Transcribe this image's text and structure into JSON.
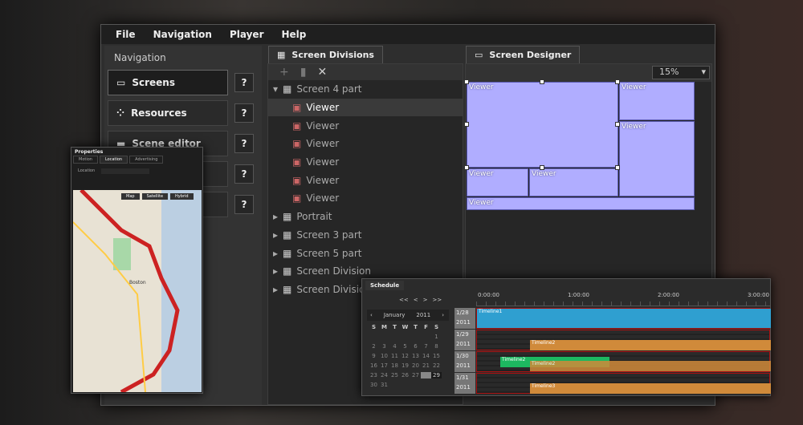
{
  "menu": [
    "File",
    "Navigation",
    "Player",
    "Help"
  ],
  "nav": {
    "title": "Navigation",
    "items": [
      "Screens",
      "Resources",
      "Scene editor"
    ],
    "help": "?"
  },
  "divisions": {
    "tab": "Screen Divisions",
    "tree": [
      {
        "label": "Screen 4 part",
        "expanded": true
      },
      {
        "label": "Viewer",
        "child": true,
        "selected": true
      },
      {
        "label": "Viewer",
        "child": true
      },
      {
        "label": "Viewer",
        "child": true
      },
      {
        "label": "Viewer",
        "child": true
      },
      {
        "label": "Viewer",
        "child": true
      },
      {
        "label": "Viewer",
        "child": true
      },
      {
        "label": "Portrait"
      },
      {
        "label": "Screen 3 part"
      },
      {
        "label": "Screen 5 part"
      },
      {
        "label": "Screen Division"
      },
      {
        "label": "Screen Division"
      }
    ]
  },
  "designer": {
    "tab": "Screen Designer",
    "zoom": "15%",
    "viewer": "Viewer"
  },
  "properties": {
    "title": "Properties",
    "tabs": [
      "Motion",
      "Location",
      "Advertising"
    ],
    "location_label": "Location",
    "map_buttons": [
      "Map",
      "Satellite",
      "Hybrid"
    ],
    "map_labels": [
      "Boston"
    ]
  },
  "schedule": {
    "title": "Schedule",
    "nav": [
      "<<",
      "<",
      ">",
      ">>"
    ],
    "month": "January",
    "year": "2011",
    "weekdays": [
      "S",
      "M",
      "T",
      "W",
      "T",
      "F",
      "S"
    ],
    "days": [
      "",
      "",
      "",
      "",
      "",
      "",
      "1",
      "2",
      "3",
      "4",
      "5",
      "6",
      "7",
      "8",
      "9",
      "10",
      "11",
      "12",
      "13",
      "14",
      "15",
      "16",
      "17",
      "18",
      "19",
      "20",
      "21",
      "22",
      "23",
      "24",
      "25",
      "26",
      "27",
      "28",
      "29",
      "30",
      "31"
    ],
    "times": [
      "0:00:00",
      "1:00:00",
      "2:00:00",
      "3:00:00"
    ],
    "rows": [
      {
        "date": "1/28",
        "year": "2011"
      },
      {
        "date": "1/29",
        "year": "2011"
      },
      {
        "date": "1/30",
        "year": "2011"
      },
      {
        "date": "1/31",
        "year": "2011"
      }
    ],
    "timelines": [
      "Timeline1",
      "Timeline2",
      "Timeline2",
      "Timeline2",
      "Timeline3"
    ],
    "colors": {
      "blue": "#2f9fd0",
      "orange": "#d08a3a",
      "green": "#1db860"
    }
  }
}
